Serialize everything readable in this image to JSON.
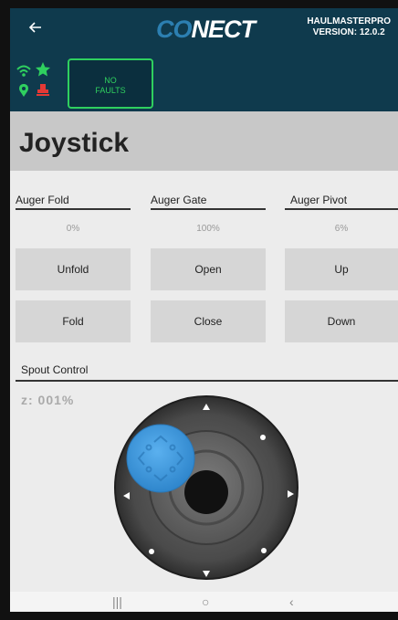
{
  "header": {
    "back_icon": "arrow-left-icon",
    "logo_part1": "CO",
    "logo_part2": "NECT",
    "brand_name": "HAULMASTERPRO",
    "version": "VERSION: 12.0.2"
  },
  "status": {
    "icons": [
      "wifi-icon",
      "star-icon",
      "location-pin-icon",
      "stamp-icon"
    ],
    "faults_line1": "NO",
    "faults_line2": "FAULTS",
    "colors": {
      "ok": "#2fd05f",
      "warn": "#e53935",
      "bar": "#0f3a4d"
    }
  },
  "page": {
    "title": "Joystick"
  },
  "augers": [
    {
      "label": "Auger Fold",
      "value": "0%",
      "btn_top": "Unfold",
      "btn_bottom": "Fold"
    },
    {
      "label": "Auger Gate",
      "value": "100%",
      "btn_top": "Open",
      "btn_bottom": "Close"
    },
    {
      "label": "Auger Pivot",
      "value": "6%",
      "btn_top": "Up",
      "btn_bottom": "Down"
    }
  ],
  "spout": {
    "label": "Spout Control",
    "z_readout": "z: 001%",
    "knob_color": "#3d9be0"
  },
  "navbar": {
    "recents": "|||",
    "home": "○",
    "back": "‹"
  }
}
